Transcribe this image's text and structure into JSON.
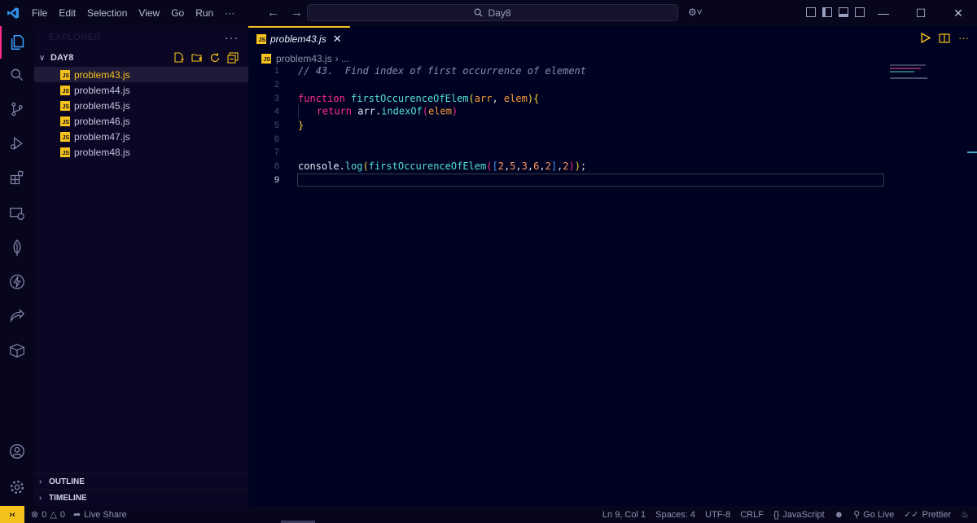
{
  "titlebar": {
    "menu": [
      "File",
      "Edit",
      "Selection",
      "View",
      "Go",
      "Run",
      "···"
    ],
    "search_text": "Day8"
  },
  "sidebar": {
    "title": "EXPLORER",
    "menu_dots": "···",
    "folder": "DAY8",
    "files": [
      {
        "name": "problem43.js",
        "selected": true
      },
      {
        "name": "problem44.js",
        "selected": false
      },
      {
        "name": "problem45.js",
        "selected": false
      },
      {
        "name": "problem46.js",
        "selected": false
      },
      {
        "name": "problem47.js",
        "selected": false
      },
      {
        "name": "problem48.js",
        "selected": false
      }
    ],
    "sections": [
      "OUTLINE",
      "TIMELINE"
    ]
  },
  "editor": {
    "tab_label": "problem43.js",
    "breadcrumb_file": "problem43.js",
    "breadcrumb_rest": "› ...",
    "current_line": 9,
    "line_numbers": [
      "1",
      "2",
      "3",
      "4",
      "5",
      "6",
      "7",
      "8",
      "9"
    ]
  },
  "code": {
    "l1_comment": "// 43.  Find index of first occurrence of element",
    "l3_kw": "function",
    "l3_fn": "firstOccurenceOfElem",
    "l3_p1": "arr",
    "l3_p2": "elem",
    "l4_kw": "return",
    "l4_obj": "arr",
    "l4_fn": "indexOf",
    "l4_arg": "elem",
    "l8_obj": "console",
    "l8_fn": "log",
    "l8_call": "firstOccurenceOfElem",
    "l8_nums": [
      "2",
      "5",
      "3",
      "6",
      "2"
    ],
    "l8_arg2": "2"
  },
  "statusbar": {
    "errors": "0",
    "warnings": "0",
    "live_share": "Live Share",
    "position": "Ln 9, Col 1",
    "spaces": "Spaces: 4",
    "encoding": "UTF-8",
    "eol": "CRLF",
    "language": "JavaScript",
    "go_live": "Go Live",
    "prettier": "Prettier"
  },
  "colors": {
    "accent": "#f4c21b",
    "activity_indicator": "#ff2b8a",
    "background": "#000221"
  }
}
